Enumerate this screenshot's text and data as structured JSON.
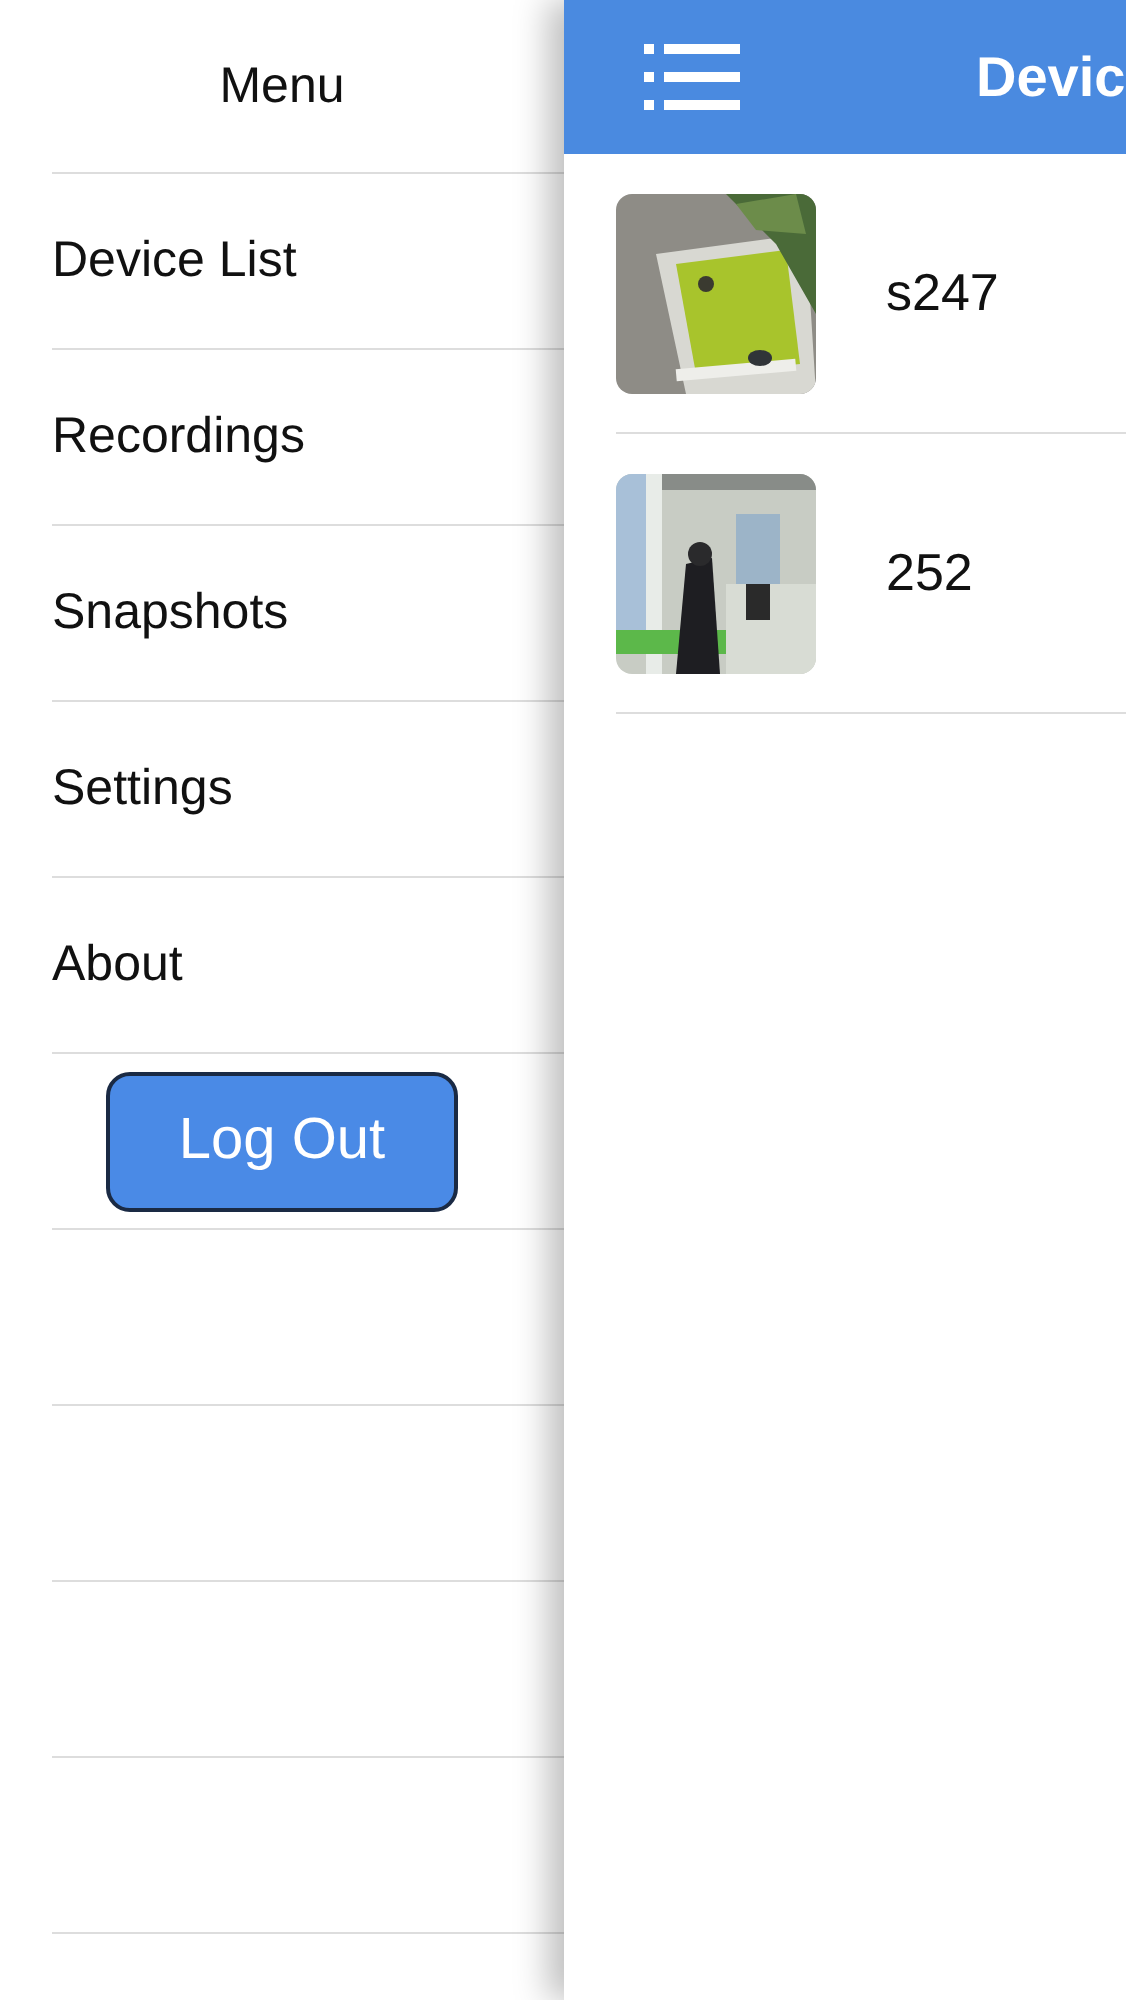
{
  "menu": {
    "title": "Menu",
    "items": [
      {
        "label": "Device List"
      },
      {
        "label": "Recordings"
      },
      {
        "label": "Snapshots"
      },
      {
        "label": "Settings"
      },
      {
        "label": "About"
      }
    ],
    "logout_button": "Log Out"
  },
  "header": {
    "title": "Devic"
  },
  "devices": [
    {
      "name": "s247"
    },
    {
      "name": "252"
    }
  ]
}
